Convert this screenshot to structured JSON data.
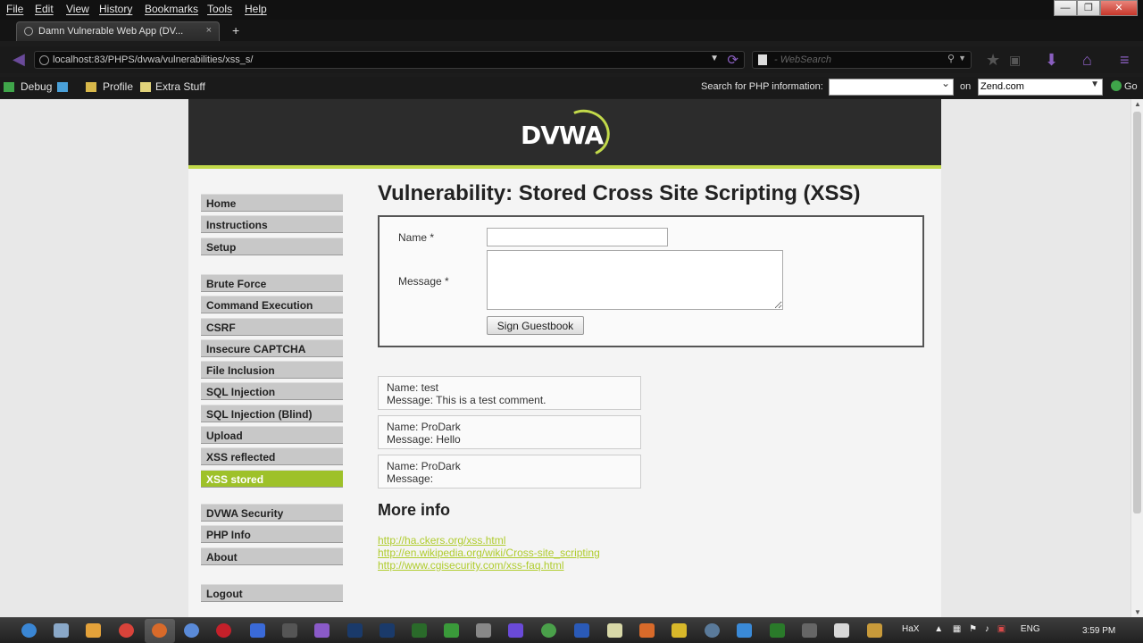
{
  "browser": {
    "menu": [
      "File",
      "Edit",
      "View",
      "History",
      "Bookmarks",
      "Tools",
      "Help"
    ],
    "window_controls": {
      "minimize": "—",
      "restore": "❐",
      "close": "✕"
    },
    "tab_title": "Damn Vulnerable Web App (DV...",
    "tab_close": "×",
    "new_tab": "+",
    "url": "localhost:83/PHPS/dvwa/vulnerabilities/xss_s/",
    "search_placeholder": "- WebSearch",
    "toolbar": {
      "debug": "Debug",
      "profile": "Profile",
      "extra_stuff": "Extra Stuff",
      "php_search_label": "Search for PHP information:",
      "on_label": "on",
      "site_option": "Zend.com",
      "go": "Go"
    }
  },
  "page": {
    "logo": "DVWA",
    "menu_groups": [
      [
        "Home",
        "Instructions",
        "Setup"
      ],
      [
        "Brute Force",
        "Command Execution",
        "CSRF",
        "Insecure CAPTCHA",
        "File Inclusion",
        "SQL Injection",
        "SQL Injection (Blind)",
        "Upload",
        "XSS reflected",
        "XSS stored"
      ],
      [
        "DVWA Security",
        "PHP Info",
        "About"
      ],
      [
        "Logout"
      ]
    ],
    "selected_menu_item": "XSS stored",
    "title": "Vulnerability: Stored Cross Site Scripting (XSS)",
    "form": {
      "name_label": "Name *",
      "name_value": "",
      "message_label": "Message *",
      "message_value": "",
      "submit_label": "Sign Guestbook"
    },
    "comments": [
      {
        "name": "Name: test",
        "message": "Message: This is a test comment."
      },
      {
        "name": "Name: ProDark",
        "message": "Message: Hello"
      },
      {
        "name": "Name: ProDark",
        "message": "Message: "
      }
    ],
    "more_info_heading": "More info",
    "links": [
      "http://ha.ckers.org/xss.html",
      "http://en.wikipedia.org/wiki/Cross-site_scripting",
      "http://www.cgisecurity.com/xss-faq.html"
    ]
  },
  "taskbar": {
    "tray_text": "HaX",
    "language": "ENG",
    "clock": "3:59 PM"
  },
  "colors": {
    "accent_green": "#9ec129",
    "link_green": "#b0cc2e",
    "header_dark": "#2c2c2c"
  }
}
